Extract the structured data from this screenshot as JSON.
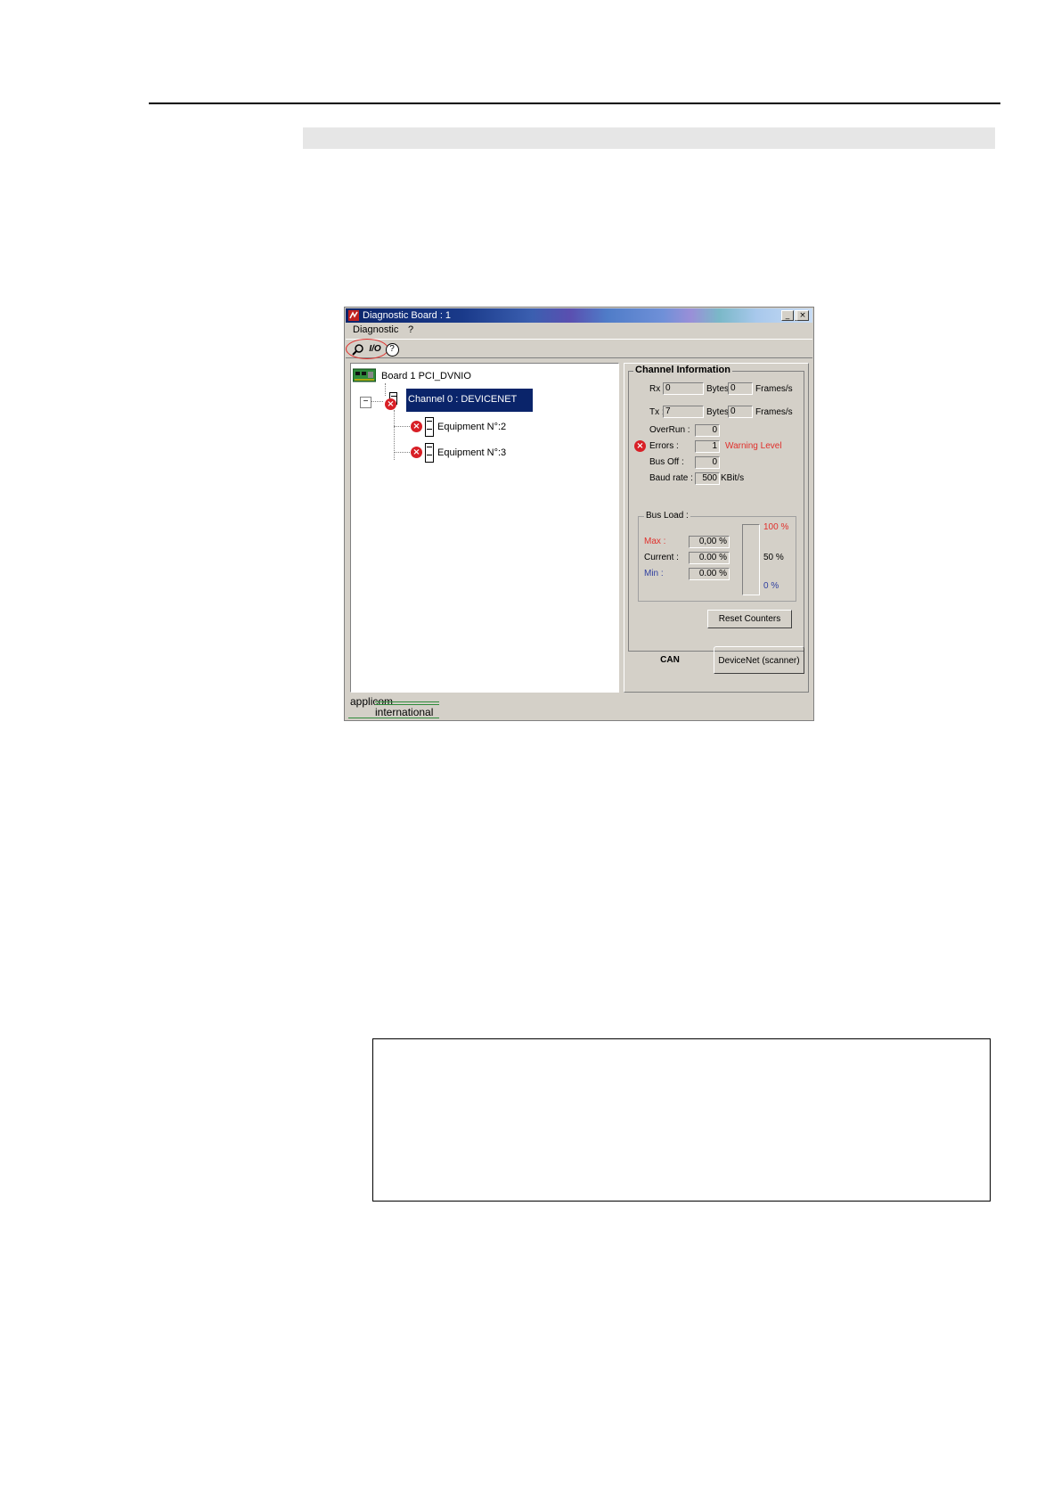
{
  "window": {
    "title": "Diagnostic Board : 1",
    "controls": {
      "minimize": "_",
      "maximize": "□",
      "close": "×"
    }
  },
  "menu": {
    "items": [
      "Diagnostic",
      "?"
    ]
  },
  "toolbar": {
    "tools": [
      {
        "icon": "magnifier-icon"
      },
      {
        "label": "I/O"
      },
      {
        "label": "?"
      }
    ]
  },
  "tree": {
    "board": "Board 1 PCI_DVNIO",
    "channel": "Channel 0 : DEVICENET",
    "equipment": [
      "Equipment N°:2",
      "Equipment N°:3"
    ],
    "collapse_glyph": "−"
  },
  "channel_info": {
    "title": "Channel Information",
    "rx": {
      "label": "Rx :",
      "bytes": "0",
      "bytes_label": "Bytes",
      "frames": "0",
      "frames_label": "Frames/s"
    },
    "tx": {
      "label": "Tx :",
      "bytes": "7",
      "bytes_label": "Bytes",
      "frames": "0",
      "frames_label": "Frames/s"
    },
    "overrun": {
      "label": "OverRun :",
      "value": "0"
    },
    "errors": {
      "label": "Errors :",
      "value": "1",
      "status": "Warning Level"
    },
    "bus_off": {
      "label": "Bus Off :",
      "value": "0"
    },
    "baud_rate": {
      "label": "Baud rate :",
      "value": "500",
      "unit": "KBit/s"
    },
    "bus_load": {
      "title": "Bus Load :",
      "max": {
        "label": "Max :",
        "value": "0,00 %"
      },
      "current": {
        "label": "Current :",
        "value": "0.00 %"
      },
      "min": {
        "label": "Min :",
        "value": "0.00 %"
      },
      "scale": {
        "top": "100 %",
        "mid": "50 %",
        "bottom": "0 %"
      },
      "level_fraction": 0
    },
    "reset_button": "Reset Counters"
  },
  "tabs": {
    "items": [
      "CAN",
      "DeviceNet (scanner)"
    ],
    "active": "CAN"
  },
  "logo": {
    "line1": "applicom",
    "line2": "international"
  },
  "colors": {
    "error": "#d81f26",
    "selection": "#0a246a",
    "warning": "#e0302c",
    "min": "#3040a0"
  }
}
